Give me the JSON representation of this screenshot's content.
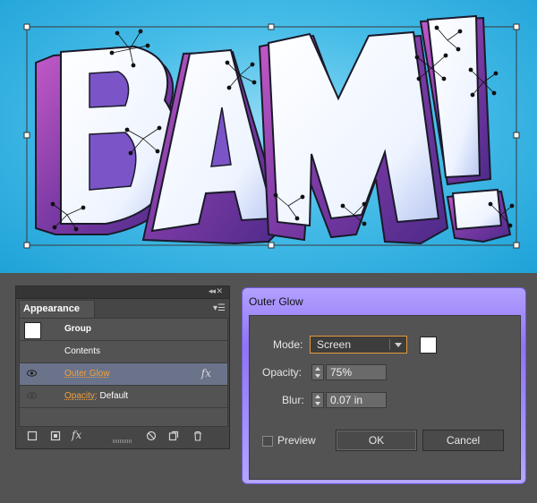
{
  "artwork": {
    "letters": [
      "B",
      "A",
      "M",
      "!"
    ]
  },
  "appearance_panel": {
    "tab_label": "Appearance",
    "rows": [
      {
        "label": "Group"
      },
      {
        "label": "Contents"
      },
      {
        "label": "Outer Glow",
        "fx": "fx"
      },
      {
        "label": "Opacity:",
        "value": "Default"
      }
    ],
    "footer_icons": [
      "new-art-icon",
      "clear-appearance-icon",
      "add-effect-icon",
      "reduce-basic-icon",
      "duplicate-item-icon",
      "delete-item-icon"
    ],
    "fx_label": "fx"
  },
  "outer_glow_dialog": {
    "title": "Outer Glow",
    "mode_label": "Mode:",
    "mode_value": "Screen",
    "opacity_label": "Opacity:",
    "opacity_value": "75%",
    "blur_label": "Blur:",
    "blur_value": "0.07 in",
    "preview_label": "Preview",
    "ok_label": "OK",
    "cancel_label": "Cancel"
  },
  "colors": {
    "canvas_blue": "#2ba9dc",
    "selection_blue": "#6a738a",
    "accent_orange": "#f2a13c",
    "dialog_purple": "#8f73f5"
  }
}
